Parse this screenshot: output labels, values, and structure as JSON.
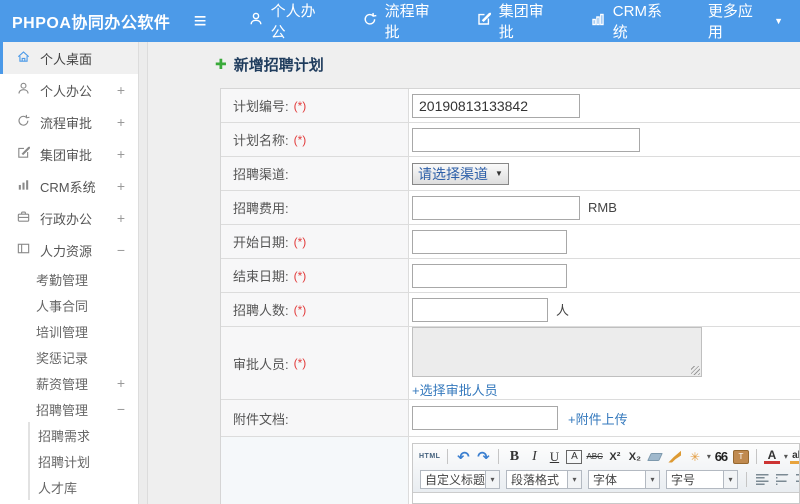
{
  "icons": {
    "add": "✚",
    "caret_down": "▼",
    "menu": "≡",
    "expand": "+",
    "collapse": "−",
    "select_caret": "▼",
    "dd_caret": "▾",
    "undo": "↶",
    "redo": "↷",
    "wand": "✳",
    "link": "∞"
  },
  "header": {
    "brand": "PHPOA协同办公软件",
    "nav": [
      {
        "label": "个人办公",
        "icon": "user"
      },
      {
        "label": "流程审批",
        "icon": "workflow"
      },
      {
        "label": "集团审批",
        "icon": "edit"
      },
      {
        "label": "CRM系统",
        "icon": "chart"
      },
      {
        "label": "更多应用",
        "icon": "",
        "caret": true
      }
    ]
  },
  "sidebar": {
    "items": [
      {
        "label": "个人桌面",
        "icon": "home",
        "expand": "",
        "active": true
      },
      {
        "label": "个人办公",
        "icon": "user",
        "expand": "+"
      },
      {
        "label": "流程审批",
        "icon": "workflow",
        "expand": "+"
      },
      {
        "label": "集团审批",
        "icon": "edit",
        "expand": "+"
      },
      {
        "label": "CRM系统",
        "icon": "chart",
        "expand": "+"
      },
      {
        "label": "行政办公",
        "icon": "briefcase",
        "expand": "+"
      },
      {
        "label": "人力资源",
        "icon": "book",
        "expand": "−"
      }
    ],
    "hr_submenu": [
      {
        "label": "考勤管理",
        "expand": ""
      },
      {
        "label": "人事合同",
        "expand": ""
      },
      {
        "label": "培训管理",
        "expand": ""
      },
      {
        "label": "奖惩记录",
        "expand": ""
      },
      {
        "label": "薪资管理",
        "expand": "+"
      },
      {
        "label": "招聘管理",
        "expand": "−"
      }
    ],
    "recruit_submenu": [
      {
        "label": "招聘需求"
      },
      {
        "label": "招聘计划"
      },
      {
        "label": "人才库"
      }
    ]
  },
  "main": {
    "title": "新增招聘计划",
    "required_mark": "(*)",
    "form_rows": [
      {
        "name": "plan-number",
        "label": "计划编号:",
        "required": true,
        "type": "text",
        "value": "20190813133842"
      },
      {
        "name": "plan-name",
        "label": "计划名称:",
        "required": true,
        "type": "text",
        "value": ""
      },
      {
        "name": "recruit-channel",
        "label": "招聘渠道:",
        "required": false,
        "type": "select",
        "value": "请选择渠道"
      },
      {
        "name": "recruit-cost",
        "label": "招聘费用:",
        "required": false,
        "type": "text",
        "value": "",
        "suffix": "RMB"
      },
      {
        "name": "start-date",
        "label": "开始日期:",
        "required": true,
        "type": "text",
        "value": ""
      },
      {
        "name": "end-date",
        "label": "结束日期:",
        "required": true,
        "type": "text",
        "value": ""
      },
      {
        "name": "headcount",
        "label": "招聘人数:",
        "required": true,
        "type": "text",
        "value": "",
        "suffix": "人"
      },
      {
        "name": "approver",
        "label": "审批人员:",
        "required": true,
        "type": "textarea",
        "link": "+选择审批人员"
      },
      {
        "name": "attachment",
        "label": "附件文档:",
        "required": false,
        "type": "file",
        "link": "+附件上传"
      },
      {
        "name": "plan-content",
        "label": "",
        "required": false,
        "type": "editor"
      }
    ],
    "editor": {
      "toolbar_row1": [
        {
          "name": "source-code-button",
          "kind": "src",
          "glyph": "HTML"
        },
        {
          "name": "sep"
        },
        {
          "name": "undo-icon",
          "kind": "undo",
          "glyph": "↶"
        },
        {
          "name": "redo-icon",
          "kind": "redo",
          "glyph": "↷"
        },
        {
          "name": "sep"
        },
        {
          "name": "bold-button",
          "kind": "b",
          "glyph": "B"
        },
        {
          "name": "italic-button",
          "kind": "i",
          "glyph": "I"
        },
        {
          "name": "underline-button",
          "kind": "u",
          "glyph": "U"
        },
        {
          "name": "char-border-button",
          "kind": "boxa",
          "glyph": "A"
        },
        {
          "name": "strikethrough-button",
          "kind": "strike",
          "glyph": "ABC"
        },
        {
          "name": "superscript-button",
          "kind": "sup",
          "glyph": "X²"
        },
        {
          "name": "subscript-button",
          "kind": "sub",
          "glyph": "X₂"
        },
        {
          "name": "eraser-icon",
          "kind": "eraser",
          "glyph": ""
        },
        {
          "name": "format-brush-icon",
          "kind": "brush",
          "glyph": ""
        },
        {
          "name": "autotypeset-icon",
          "kind": "wand",
          "glyph": "✳",
          "caret": true
        },
        {
          "name": "blockquote-button",
          "kind": "quote",
          "glyph": "66"
        },
        {
          "name": "paste-text-icon",
          "kind": "paste",
          "glyph": "T"
        },
        {
          "name": "sep"
        },
        {
          "name": "font-color-button",
          "kind": "fontcolor",
          "glyph": "A",
          "caret": true
        },
        {
          "name": "highlight-button",
          "kind": "hilite",
          "glyph": "ab",
          "caret": true
        },
        {
          "name": "sep"
        },
        {
          "name": "insert-table-icon",
          "kind": "cuticon",
          "glyph": ""
        }
      ],
      "dropdowns": [
        {
          "name": "custom-title-select",
          "label": "自定义标题"
        },
        {
          "name": "paragraph-format-select",
          "label": "段落格式"
        },
        {
          "name": "font-family-select",
          "label": "字体"
        },
        {
          "name": "font-size-select",
          "label": "字号"
        }
      ],
      "toolbar_row2_icons": [
        {
          "name": "align-left-icon",
          "kind": "ag-left"
        },
        {
          "name": "align-center-icon",
          "kind": "ag-center"
        },
        {
          "name": "align-right-icon",
          "kind": "ag-right"
        },
        {
          "name": "align-justify-icon",
          "kind": "ag-justify"
        },
        {
          "name": "insert-link-icon",
          "kind": "link",
          "glyph": "∞"
        },
        {
          "name": "unlink-icon",
          "kind": "link",
          "glyph": "∞"
        }
      ]
    }
  },
  "colors": {
    "header_blue": "#4c9ae8",
    "accent_blue": "#4a99e8",
    "link_blue": "#3579bd",
    "title_navy": "#1f3c5d",
    "required_red": "#e23b3b",
    "add_green": "#3aaa3a"
  }
}
